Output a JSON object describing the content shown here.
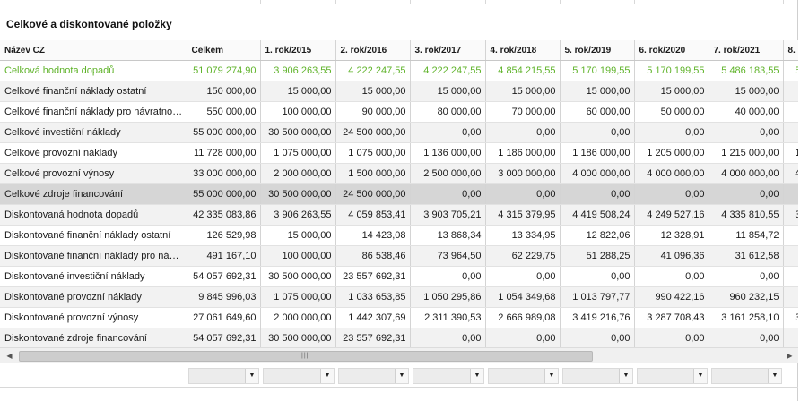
{
  "panel": {
    "title": "Celkové a diskontované položky"
  },
  "table": {
    "columns": [
      "Název CZ",
      "Celkem",
      "1. rok/2015",
      "2. rok/2016",
      "3. rok/2017",
      "4. rok/2018",
      "5. rok/2019",
      "6. rok/2020",
      "7. rok/2021",
      "8."
    ],
    "rows": [
      {
        "cells": [
          "Celková hodnota dopadů",
          "51 079 274,90",
          "3 906 263,55",
          "4 222 247,55",
          "4 222 247,55",
          "4 854 215,55",
          "5 170 199,55",
          "5 170 199,55",
          "5 486 183,55",
          "5"
        ]
      },
      {
        "cells": [
          "Celkové finanční náklady ostatní",
          "150 000,00",
          "15 000,00",
          "15 000,00",
          "15 000,00",
          "15 000,00",
          "15 000,00",
          "15 000,00",
          "15 000,00",
          ""
        ]
      },
      {
        "cells": [
          "Celkové finanční náklady pro návratnou finanční výpomoc",
          "550 000,00",
          "100 000,00",
          "90 000,00",
          "80 000,00",
          "70 000,00",
          "60 000,00",
          "50 000,00",
          "40 000,00",
          ""
        ]
      },
      {
        "cells": [
          "Celkové investiční náklady",
          "55 000 000,00",
          "30 500 000,00",
          "24 500 000,00",
          "0,00",
          "0,00",
          "0,00",
          "0,00",
          "0,00",
          ""
        ]
      },
      {
        "cells": [
          "Celkové provozní náklady",
          "11 728 000,00",
          "1 075 000,00",
          "1 075 000,00",
          "1 136 000,00",
          "1 186 000,00",
          "1 186 000,00",
          "1 205 000,00",
          "1 215 000,00",
          "1"
        ]
      },
      {
        "cells": [
          "Celkové provozní výnosy",
          "33 000 000,00",
          "2 000 000,00",
          "1 500 000,00",
          "2 500 000,00",
          "3 000 000,00",
          "4 000 000,00",
          "4 000 000,00",
          "4 000 000,00",
          "4"
        ]
      },
      {
        "cells": [
          "Celkové zdroje financování",
          "55 000 000,00",
          "30 500 000,00",
          "24 500 000,00",
          "0,00",
          "0,00",
          "0,00",
          "0,00",
          "0,00",
          ""
        ]
      },
      {
        "cells": [
          "Diskontovaná hodnota dopadů",
          "42 335 083,86",
          "3 906 263,55",
          "4 059 853,41",
          "3 903 705,21",
          "4 315 379,95",
          "4 419 508,24",
          "4 249 527,16",
          "4 335 810,55",
          "3"
        ]
      },
      {
        "cells": [
          "Diskontované finanční náklady ostatní",
          "126 529,98",
          "15 000,00",
          "14 423,08",
          "13 868,34",
          "13 334,95",
          "12 822,06",
          "12 328,91",
          "11 854,72",
          ""
        ]
      },
      {
        "cells": [
          "Diskontované finanční náklady pro návratnou finanční výpomoc",
          "491 167,10",
          "100 000,00",
          "86 538,46",
          "73 964,50",
          "62 229,75",
          "51 288,25",
          "41 096,36",
          "31 612,58",
          ""
        ]
      },
      {
        "cells": [
          "Diskontované investiční náklady",
          "54 057 692,31",
          "30 500 000,00",
          "23 557 692,31",
          "0,00",
          "0,00",
          "0,00",
          "0,00",
          "0,00",
          ""
        ]
      },
      {
        "cells": [
          "Diskontované provozní náklady",
          "9 845 996,03",
          "1 075 000,00",
          "1 033 653,85",
          "1 050 295,86",
          "1 054 349,68",
          "1 013 797,77",
          "990 422,16",
          "960 232,15",
          ""
        ]
      },
      {
        "cells": [
          "Diskontované provozní výnosy",
          "27 061 649,60",
          "2 000 000,00",
          "1 442 307,69",
          "2 311 390,53",
          "2 666 989,08",
          "3 419 216,76",
          "3 287 708,43",
          "3 161 258,10",
          "3"
        ]
      },
      {
        "cells": [
          "Diskontované zdroje financování",
          "54 057 692,31",
          "30 500 000,00",
          "23 557 692,31",
          "0,00",
          "0,00",
          "0,00",
          "0,00",
          "0,00",
          ""
        ]
      }
    ]
  },
  "styles": {
    "green_row_color": "#5fb32a",
    "selected_row_bg": "#d6d6d6"
  },
  "icons": {
    "scroll_left": "triangle-left",
    "scroll_right": "triangle-right",
    "scroll_grip": "grip-lines",
    "filter_dropdown": "caret-down"
  }
}
